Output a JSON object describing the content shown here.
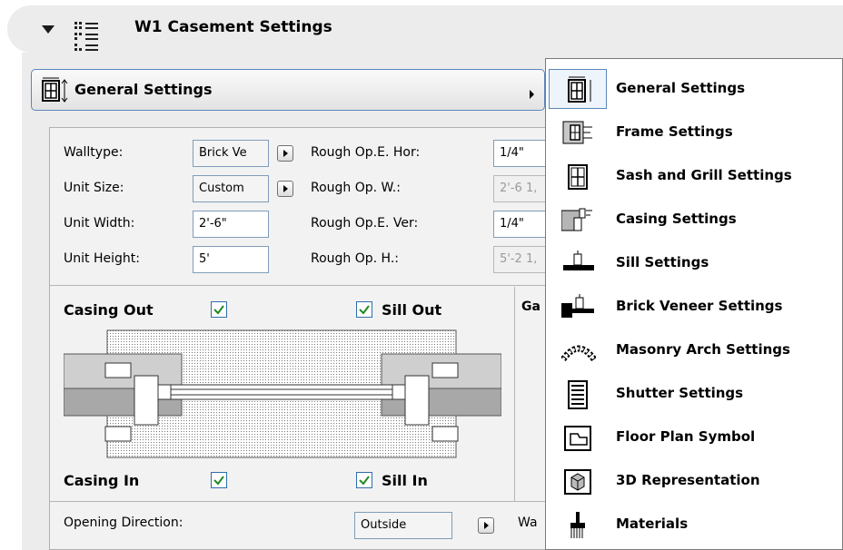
{
  "header": {
    "title": "W1 Casement Settings"
  },
  "page_selector": {
    "label": "General Settings"
  },
  "fields": {
    "walltype": {
      "label": "Walltype:",
      "value": "Brick Ve"
    },
    "unit_size": {
      "label": "Unit Size:",
      "value": "Custom"
    },
    "unit_width": {
      "label": "Unit Width:",
      "value": "2'-6\""
    },
    "unit_height": {
      "label": "Unit Height:",
      "value": "5'"
    },
    "rough_op_e_hor": {
      "label": "Rough Op.E. Hor:",
      "value": "1/4\""
    },
    "rough_op_w": {
      "label": "Rough Op. W.:",
      "value": "2'-6 1,"
    },
    "rough_op_e_ver": {
      "label": "Rough Op.E. Ver:",
      "value": "1/4\""
    },
    "rough_op_h": {
      "label": "Rough Op. H.:",
      "value": "5'-2 1,"
    }
  },
  "checkboxes": {
    "casing_out": {
      "label": "Casing Out",
      "checked": true
    },
    "sill_out": {
      "label": "Sill Out",
      "checked": true
    },
    "casing_in": {
      "label": "Casing In",
      "checked": true
    },
    "sill_in": {
      "label": "Sill In",
      "checked": true
    }
  },
  "truncated": {
    "ga": "Ga",
    "wa": "Wa"
  },
  "opening": {
    "label": "Opening Direction:",
    "value": "Outside"
  },
  "menu": {
    "items": [
      {
        "label": "General Settings",
        "icon": "general-settings-icon"
      },
      {
        "label": "Frame Settings",
        "icon": "frame-icon"
      },
      {
        "label": "Sash and Grill Settings",
        "icon": "sash-grill-icon"
      },
      {
        "label": "Casing Settings",
        "icon": "casing-icon"
      },
      {
        "label": "Sill Settings",
        "icon": "sill-icon"
      },
      {
        "label": "Brick Veneer Settings",
        "icon": "brick-veneer-icon"
      },
      {
        "label": "Masonry Arch Settings",
        "icon": "masonry-arch-icon"
      },
      {
        "label": "Shutter Settings",
        "icon": "shutter-icon"
      },
      {
        "label": "Floor Plan Symbol",
        "icon": "floor-plan-icon"
      },
      {
        "label": "3D Representation",
        "icon": "3d-representation-icon"
      },
      {
        "label": "Materials",
        "icon": "materials-icon"
      }
    ]
  },
  "colors": {
    "accent": "#5a87b8",
    "check": "#1f8a1f",
    "panel": "#ececec"
  }
}
